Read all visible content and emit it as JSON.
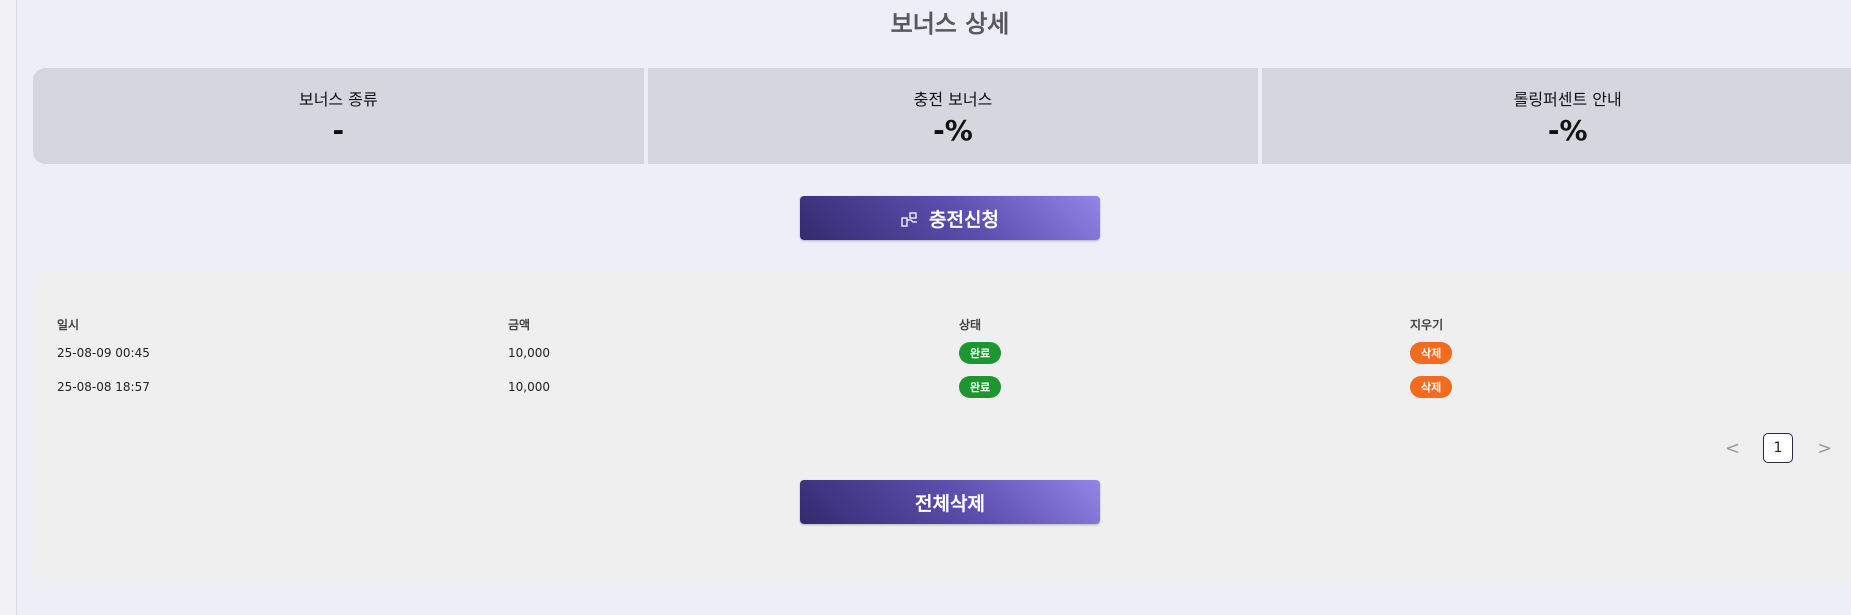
{
  "page": {
    "title": "보너스 상세"
  },
  "info_cards": [
    {
      "label": "보너스 종류",
      "value": "-"
    },
    {
      "label": "충전 보너스",
      "value": "-%"
    },
    {
      "label": "롤링퍼센트 안내",
      "value": "-%"
    }
  ],
  "charge_button": {
    "label": "충전신청",
    "icon": "hand-coins-icon"
  },
  "history": {
    "headers": [
      "일시",
      "금액",
      "상태",
      "지우기"
    ],
    "rows": [
      {
        "datetime": "25-08-09 00:45",
        "amount": "10,000",
        "status": "완료",
        "action": "삭제"
      },
      {
        "datetime": "25-08-08 18:57",
        "amount": "10,000",
        "status": "완료",
        "action": "삭제"
      }
    ]
  },
  "pagination": {
    "prev": "<",
    "current": "1",
    "next": ">"
  },
  "delete_all_button": {
    "label": "전체삭제"
  },
  "colors": {
    "status_done": "#1e962f",
    "delete_badge": "#f26b1e",
    "button_gradient_start": "#332a6e",
    "button_gradient_end": "#9384e8"
  }
}
